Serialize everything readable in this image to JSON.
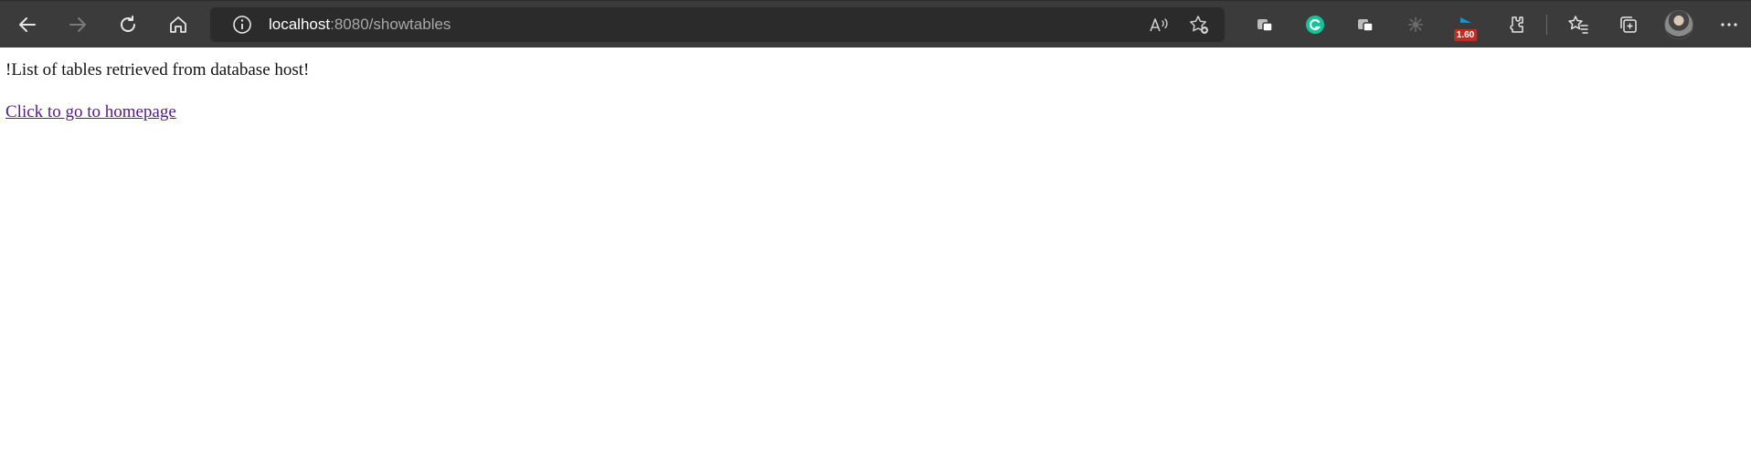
{
  "browser": {
    "url_host": "localhost",
    "url_path": ":8080/showtables",
    "extension_badge": "1.60",
    "icons": [
      "back-icon",
      "forward-icon",
      "refresh-icon",
      "home-icon",
      "site-info-icon",
      "read-aloud-icon",
      "add-favorite-icon",
      "extension-icon",
      "grammarly-icon",
      "extension-icon",
      "spider-icon",
      "flag-icon",
      "puzzle-icon",
      "favorites-icon",
      "collections-icon",
      "profile-avatar",
      "more-icon"
    ]
  },
  "page": {
    "message": "!List of tables retrieved from database host!",
    "link_text": "Click to go to homepage"
  },
  "colors": {
    "toolbar_bg": "#3b3b3b",
    "address_bg": "#2b2b2b",
    "link": "#551a8b",
    "grammarly": "#15c39a",
    "badge": "#c42b1c"
  }
}
